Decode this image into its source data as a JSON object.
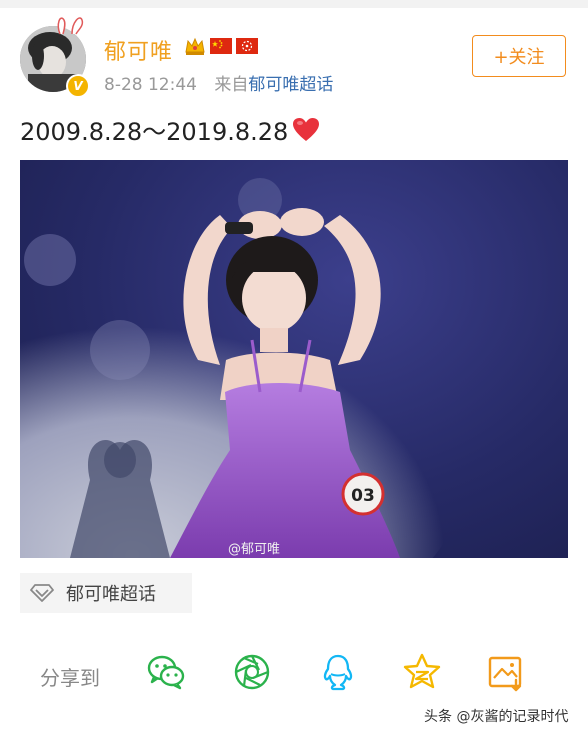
{
  "post": {
    "username": "郁可唯",
    "time": "8-28 12:44",
    "source_prefix": "来自",
    "source_name": "郁可唯超话",
    "follow_label": "+关注",
    "text": "2009.8.28～2019.8.28",
    "avatar_badge": "V"
  },
  "photo": {
    "watermark": "@郁可唯",
    "tag_number": "03"
  },
  "topic": {
    "label": "郁可唯超话"
  },
  "share": {
    "label": "分享到",
    "targets": [
      "wechat-icon",
      "moments-icon",
      "qq-icon",
      "qzone-icon",
      "save-image-icon"
    ]
  },
  "footer": {
    "credit": "头条 @灰酱的记录时代"
  },
  "colors": {
    "username": "#f0a020",
    "follow": "#f28c1e",
    "link": "#3a6fb0",
    "share_green": "#2bb24c",
    "share_blue": "#12b7f5",
    "share_yellow": "#f5b800",
    "share_orange": "#f29a1a"
  }
}
